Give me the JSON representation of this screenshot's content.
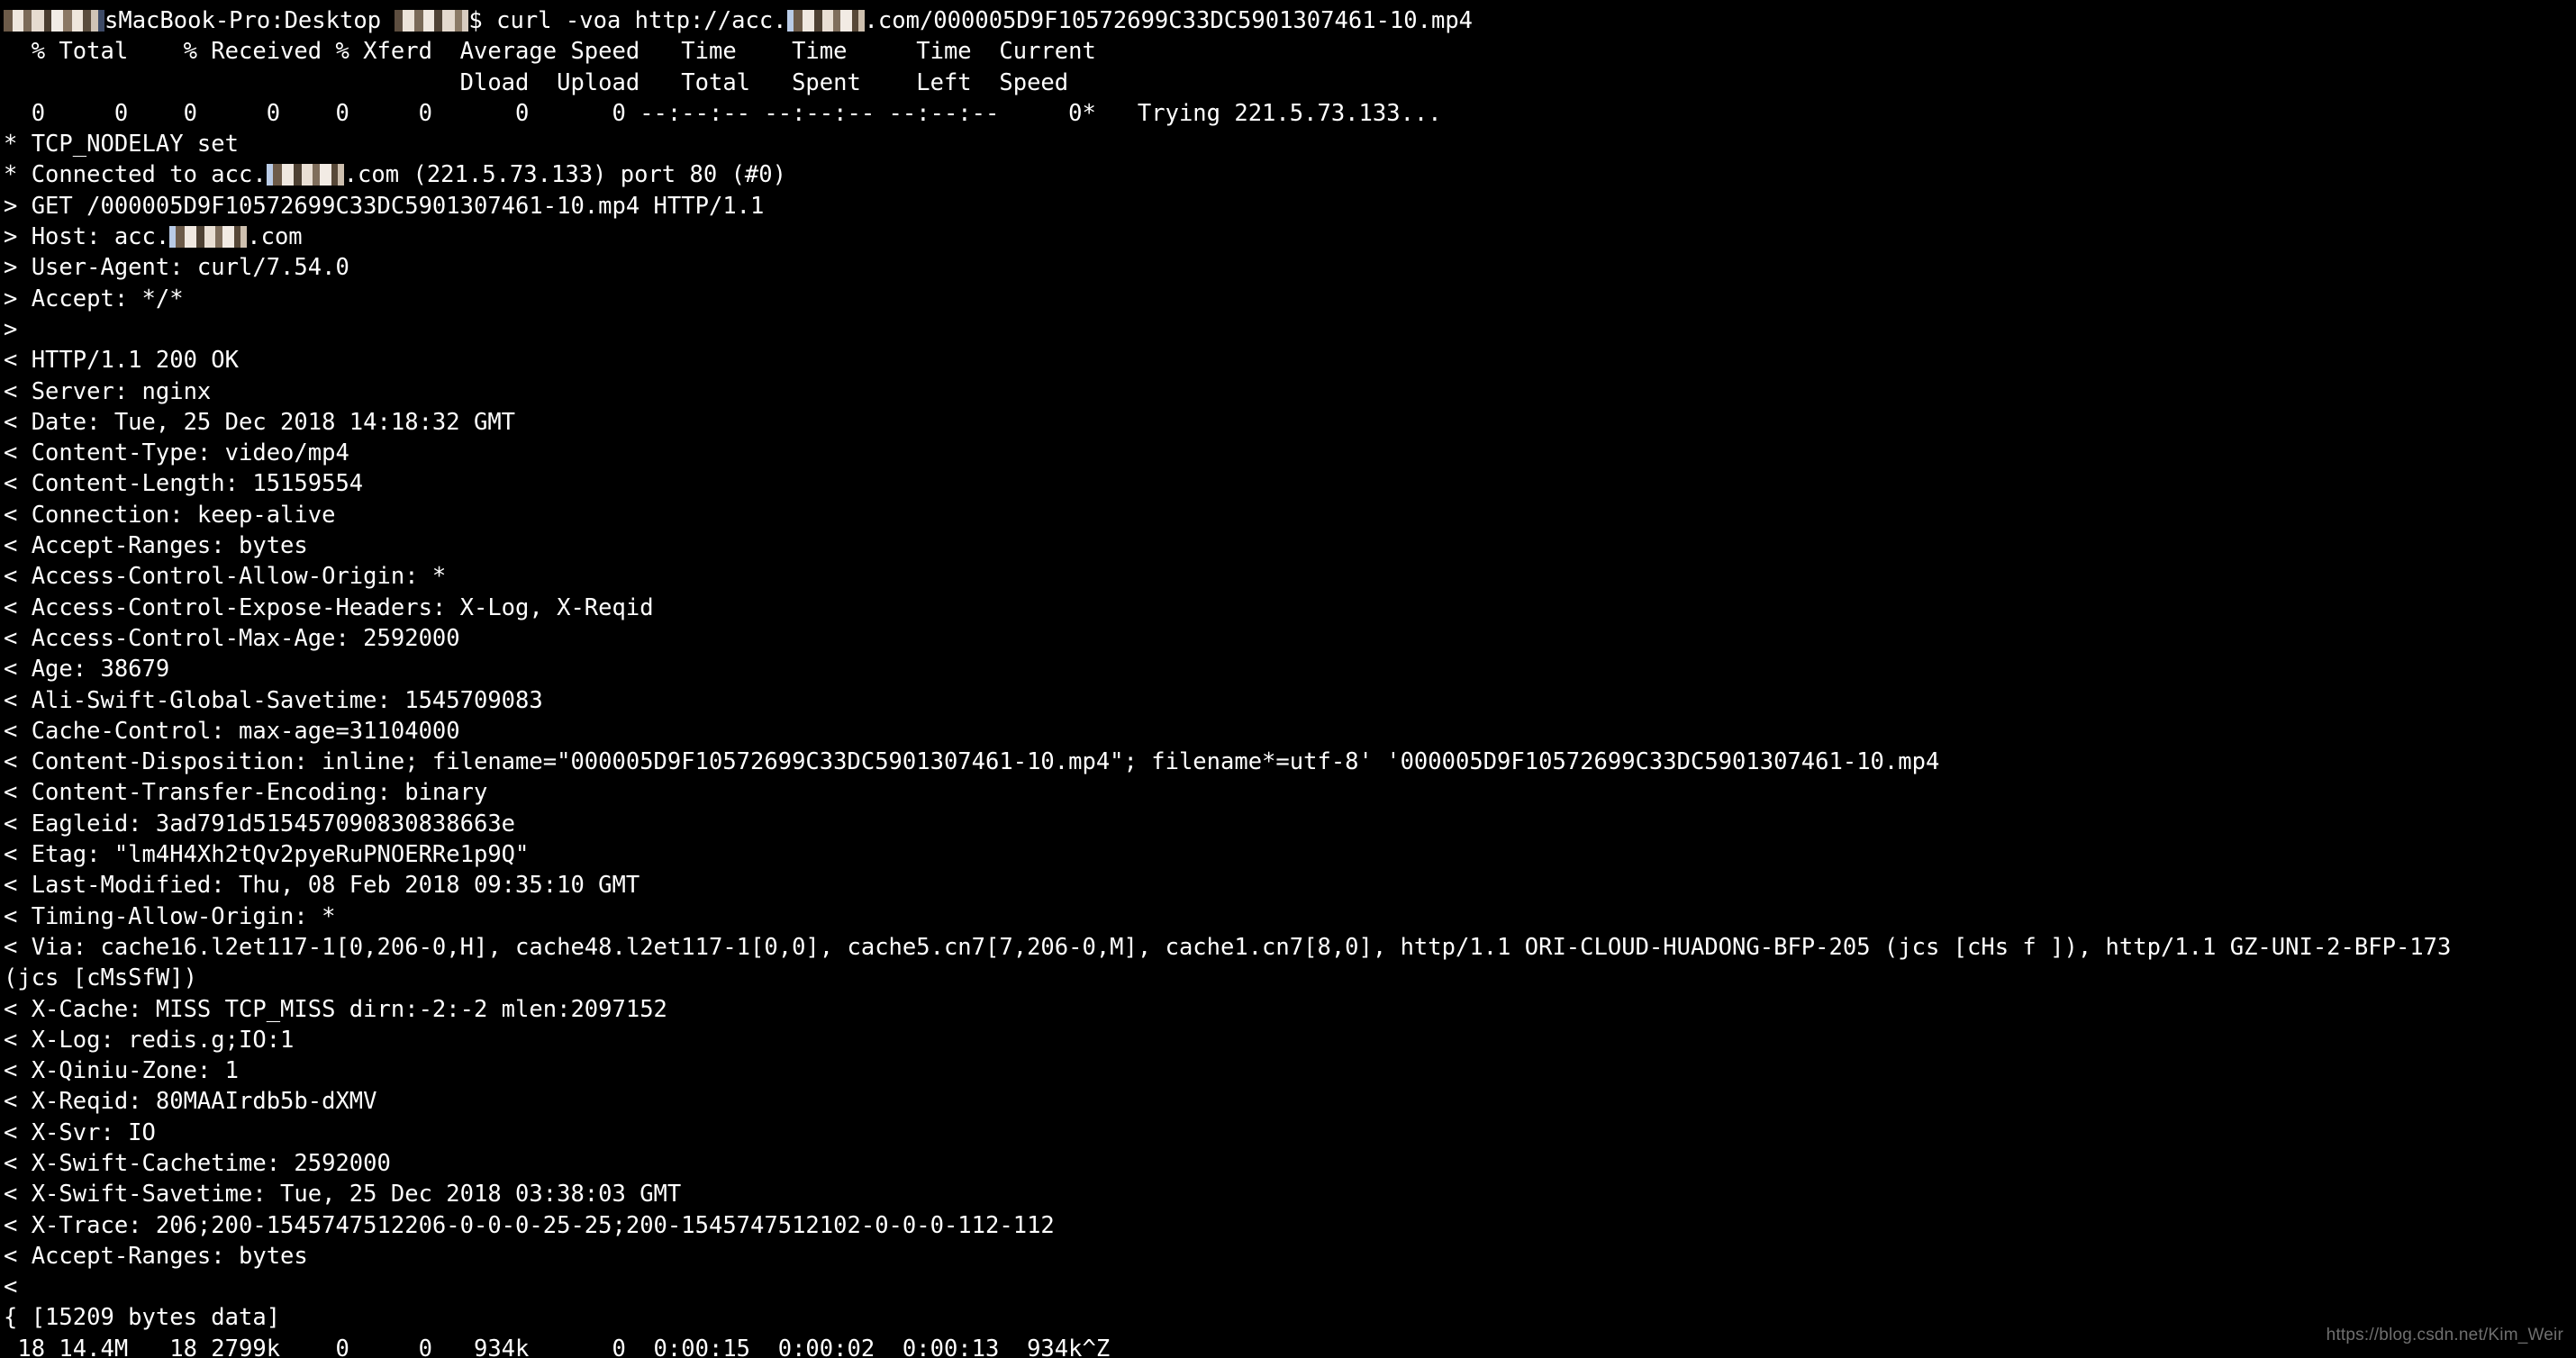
{
  "terminal": {
    "shell_prompt": {
      "user_host_redacted": "[redacted]",
      "host_suffix": "sMacBook-Pro:Desktop",
      "user_redacted": "[redacted]",
      "prompt_symbol": "$",
      "command": "curl -voa http://acc.",
      "domain_redacted": "[redacted]",
      "url_tail": ".com/000005D9F10572699C33DC5901307461-10.mp4"
    },
    "progress_header_row1": "  % Total    % Received % Xferd  Average Speed   Time    Time     Time  Current",
    "progress_header_row2": "                                 Dload  Upload   Total   Spent    Left  Speed",
    "progress_first_row": "  0     0    0     0    0     0      0      0 --:--:-- --:--:-- --:--:--     0*   Trying 221.5.73.133...",
    "lines": [
      "* TCP_NODELAY set",
      "* Connected to acc.\u0000REDACT\u0000.com (221.5.73.133) port 80 (#0)",
      "> GET /000005D9F10572699C33DC5901307461-10.mp4 HTTP/1.1",
      "> Host: acc.\u0000REDACT\u0000.com",
      "> User-Agent: curl/7.54.0",
      "> Accept: */*",
      ">",
      "< HTTP/1.1 200 OK",
      "< Server: nginx",
      "< Date: Tue, 25 Dec 2018 14:18:32 GMT",
      "< Content-Type: video/mp4",
      "< Content-Length: 15159554",
      "< Connection: keep-alive",
      "< Accept-Ranges: bytes",
      "< Access-Control-Allow-Origin: *",
      "< Access-Control-Expose-Headers: X-Log, X-Reqid",
      "< Access-Control-Max-Age: 2592000",
      "< Age: 38679",
      "< Ali-Swift-Global-Savetime: 1545709083",
      "< Cache-Control: max-age=31104000",
      "< Content-Disposition: inline; filename=\"000005D9F10572699C33DC5901307461-10.mp4\"; filename*=utf-8' '000005D9F10572699C33DC5901307461-10.mp4",
      "< Content-Transfer-Encoding: binary",
      "< Eagleid: 3ad791d515457090830838663e",
      "< Etag: \"lm4H4Xh2tQv2pyeRuPNOERRe1p9Q\"",
      "< Last-Modified: Thu, 08 Feb 2018 09:35:10 GMT",
      "< Timing-Allow-Origin: *",
      "< Via: cache16.l2et117-1[0,206-0,H], cache48.l2et117-1[0,0], cache5.cn7[7,206-0,M], cache1.cn7[8,0], http/1.1 ORI-CLOUD-HUADONG-BFP-205 (jcs [cHs f ]), http/1.1 GZ-UNI-2-BFP-173",
      "(jcs [cMsSfW])",
      "< X-Cache: MISS TCP_MISS dirn:-2:-2 mlen:2097152",
      "< X-Log: redis.g;IO:1",
      "< X-Qiniu-Zone: 1",
      "< X-Reqid: 80MAAIrdb5b-dXMV",
      "< X-Svr: IO",
      "< X-Swift-Cachetime: 2592000",
      "< X-Swift-Savetime: Tue, 25 Dec 2018 03:38:03 GMT",
      "< X-Trace: 206;200-1545747512206-0-0-0-25-25;200-1545747512102-0-0-0-112-112",
      "< Accept-Ranges: bytes",
      "<",
      "{ [15209 bytes data]",
      " 18 14.4M   18 2799k    0     0   934k      0  0:00:15  0:00:02  0:00:13  934k^Z"
    ]
  },
  "watermark": {
    "text": "https://blog.csdn.net/Kim_Weir"
  },
  "colors": {
    "background": "#000000",
    "foreground": "#ffffff",
    "watermark": "#6f6f6f",
    "redaction_a": "#cdbfae",
    "redaction_b": "#7a6a58",
    "redaction_c": "#f0e6dc",
    "redaction_d": "#3a4a6a"
  }
}
